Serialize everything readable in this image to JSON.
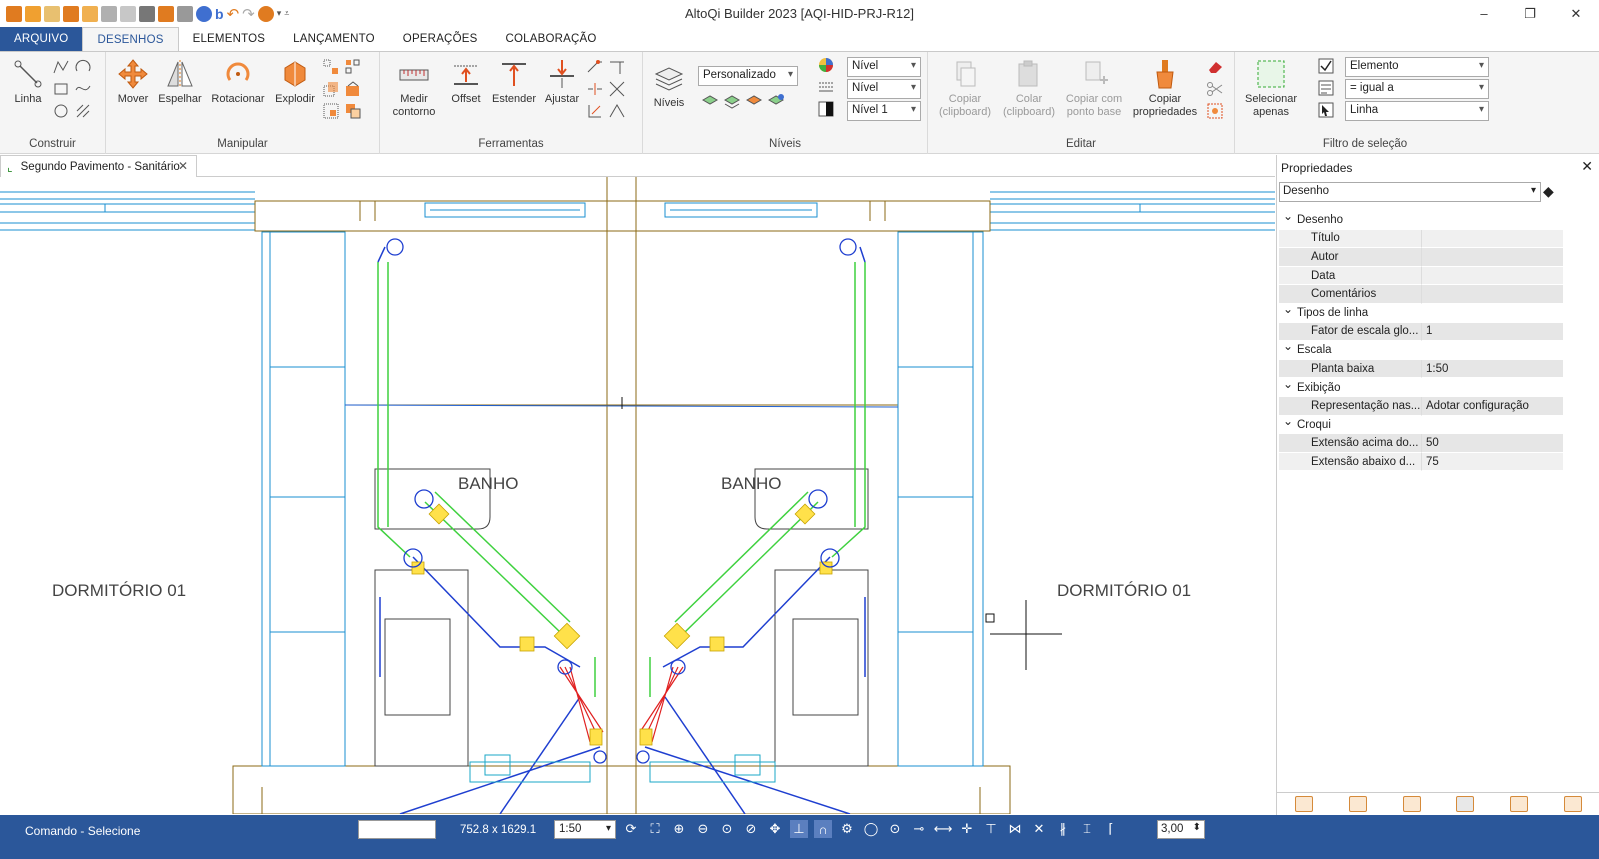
{
  "app": {
    "title": "AltoQi Builder 2023 [AQI-HID-PRJ-R12]",
    "window_controls": [
      "–",
      "❐",
      "✕"
    ]
  },
  "ribbon_tabs": [
    "ARQUIVO",
    "DESENHOS",
    "ELEMENTOS",
    "LANÇAMENTO",
    "OPERAÇÕES",
    "COLABORAÇÃO"
  ],
  "groups": {
    "construir": {
      "label": "Construir",
      "linha": "Linha"
    },
    "manipular": {
      "label": "Manipular",
      "mover": "Mover",
      "espelhar": "Espelhar",
      "rotacionar": "Rotacionar",
      "explodir": "Explodir"
    },
    "ferramentas": {
      "label": "Ferramentas",
      "medir": "Medir",
      "contorno": "contorno",
      "offset": "Offset",
      "estender": "Estender",
      "ajustar": "Ajustar"
    },
    "niveis": {
      "label": "Níveis",
      "niveis_btn": "Níveis",
      "personalizado": "Personalizado",
      "nivel_a": "Nível",
      "nivel_b": "Nível",
      "nivel_c": "Nível 1"
    },
    "editar": {
      "label": "Editar",
      "copiar_a": "Copiar",
      "copiar_a2": "(clipboard)",
      "colar": "Colar",
      "colar2": "(clipboard)",
      "copiar_ponto": "Copiar com",
      "copiar_ponto2": "ponto base",
      "copiar_props": "Copiar",
      "copiar_props2": "propriedades"
    },
    "filtro": {
      "label": "Filtro de seleção",
      "selecionar": "Selecionar",
      "apenas": "apenas",
      "combo1": "Elemento",
      "combo2": "= igual a",
      "combo3": "Linha"
    }
  },
  "document_tab": "Segundo Pavimento - Sanitário",
  "drawing": {
    "room_left": "DORMITÓRIO 01",
    "room_right": "DORMITÓRIO 01",
    "bath_left": "BANHO",
    "bath_right": "BANHO"
  },
  "properties": {
    "header": "Propriedades",
    "selector": "Desenho",
    "rows": [
      {
        "type": "cat",
        "label": "Desenho"
      },
      {
        "type": "p",
        "label": "Título",
        "value": ""
      },
      {
        "type": "p",
        "label": "Autor",
        "value": ""
      },
      {
        "type": "p",
        "label": "Data",
        "value": ""
      },
      {
        "type": "p",
        "label": "Comentários",
        "value": ""
      },
      {
        "type": "cat",
        "label": "Tipos de linha"
      },
      {
        "type": "p",
        "label": "Fator de escala glo...",
        "value": "1"
      },
      {
        "type": "cat",
        "label": "Escala"
      },
      {
        "type": "p",
        "label": "Planta baixa",
        "value": "1:50"
      },
      {
        "type": "cat",
        "label": "Exibição"
      },
      {
        "type": "p",
        "label": "Representação nas...",
        "value": "Adotar configuração"
      },
      {
        "type": "cat",
        "label": "Croqui"
      },
      {
        "type": "p",
        "label": "Extensão acima do...",
        "value": "50"
      },
      {
        "type": "p",
        "label": "Extensão abaixo d...",
        "value": "75"
      }
    ]
  },
  "status": {
    "command": "Comando - Selecione",
    "coords": "752.8 x 1629.1",
    "scale": "1:50",
    "line_width": "3,00"
  },
  "colors": {
    "accent": "#2b579a",
    "wall": "#8b6914",
    "pipe_green": "#3fd13f",
    "pipe_blue": "#1f3fd0",
    "pipe_red": "#e02020",
    "fitting_yellow": "#ffe14a"
  }
}
